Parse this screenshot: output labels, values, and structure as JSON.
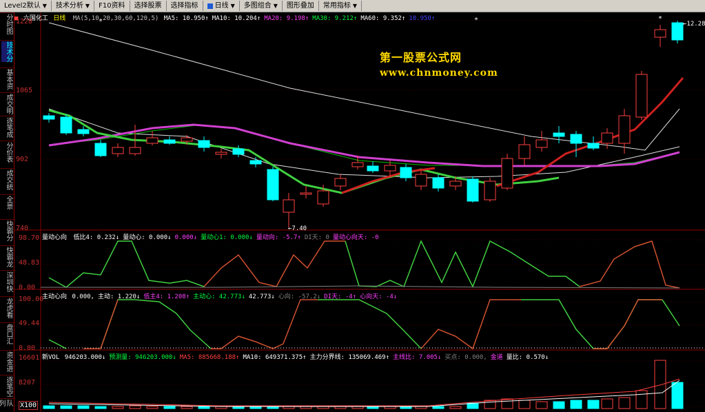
{
  "toolbar": {
    "items": [
      {
        "label": "Level2默认",
        "arrow": true
      },
      {
        "label": "技术分析",
        "arrow": true
      },
      {
        "label": "F10资料",
        "arrow": false
      },
      {
        "label": "选择股票",
        "arrow": false
      },
      {
        "label": "选择指标",
        "arrow": false
      },
      {
        "label": "日线",
        "arrow": true
      },
      {
        "label": "多图组合",
        "arrow": true
      },
      {
        "label": "图形叠加",
        "arrow": false
      },
      {
        "label": "常用指标",
        "arrow": true
      }
    ]
  },
  "sidebar": {
    "items": [
      "分时图",
      "技术分",
      "基本资",
      "成交明",
      "逐笔成",
      "分价表",
      "成交统",
      "全景",
      "快霸分",
      "快霸龙",
      "深圳快",
      "龙虎看",
      "盘口汇",
      "资金进",
      "逐笔空",
      "队列"
    ]
  },
  "main_panel": {
    "name": "六国化工",
    "period": "日线",
    "ma_params": "MA(5,10,20,30,60,120,5)",
    "ma_items": [
      {
        "label": "MA5: 10.950↑",
        "color": "#ffffff"
      },
      {
        "label": "MA10: 10.204↑",
        "color": "#ffffff"
      },
      {
        "label": "MA20: 9.198↑",
        "color": "#ff40ff"
      },
      {
        "label": "MA30: 9.212↑",
        "color": "#00ff40"
      },
      {
        "label": "MA60: 9.352↑",
        "color": "#ffffff"
      },
      {
        "label": "10.950↑",
        "color": "#4040ff"
      }
    ],
    "y_labels": [
      "1228",
      "1065",
      "902",
      "740"
    ],
    "high_label": "12.28",
    "low_label": "7.40"
  },
  "watermark": {
    "line1": "第一股票公式网",
    "line2": "www.chnmoney.com"
  },
  "panel2": {
    "title": "量动心向",
    "items": [
      {
        "label": "低比4: 0.232↓",
        "color": "#ffffff"
      },
      {
        "label": "量动心: 0.000↓",
        "color": "#ffffff"
      },
      {
        "label": "0.000↓",
        "color": "#ff40ff"
      },
      {
        "label": "量动心1: 0.000↓",
        "color": "#00ff40"
      },
      {
        "label": "量动向: -5.7↑",
        "color": "#ff40ff"
      },
      {
        "label": "DI天: 0",
        "color": "#808080"
      },
      {
        "label": "量动心向天: -0",
        "color": "#ff40ff"
      }
    ],
    "y_labels": [
      "98.70",
      "48.83",
      "0.00"
    ]
  },
  "panel3": {
    "title": "主动心向",
    "items": [
      {
        "label": "0.000,",
        "color": "#ffffff"
      },
      {
        "label": "主动: 1.220↓",
        "color": "#ffffff"
      },
      {
        "label": "低主4: 1.208↑",
        "color": "#ff40ff"
      },
      {
        "label": "主动心: 42.773↓",
        "color": "#00ff40"
      },
      {
        "label": "42.773↓",
        "color": "#ffffff"
      },
      {
        "label": "心向: -57.2↓",
        "color": "#808080"
      },
      {
        "label": "DI天: -4↑",
        "color": "#ff40ff"
      },
      {
        "label": "心向天: -4↓",
        "color": "#ff40ff"
      }
    ],
    "y_labels": [
      "100.00",
      "49.44",
      "0.00"
    ]
  },
  "panel4": {
    "title": "新VOL",
    "items": [
      {
        "label": "946203.000↓",
        "color": "#ffffff"
      },
      {
        "label": "预测量: 946203.000↓",
        "color": "#00ff40"
      },
      {
        "label": "MA5: 885668.188↑",
        "color": "#ff4040"
      },
      {
        "label": "MA10: 649371.375↑",
        "color": "#ffffff"
      },
      {
        "label": "主力分界线: 135069.469↑",
        "color": "#ffffff"
      },
      {
        "label": "主线比: 7.005↓",
        "color": "#ff40ff"
      },
      {
        "label": "买点: 0.000,",
        "color": "#808080"
      },
      {
        "label": "金道",
        "color": "#ff40ff"
      },
      {
        "label": "量比: 0.570↓",
        "color": "#ffffff"
      }
    ],
    "y_labels": [
      "16601",
      "8207",
      "X100"
    ]
  }
}
